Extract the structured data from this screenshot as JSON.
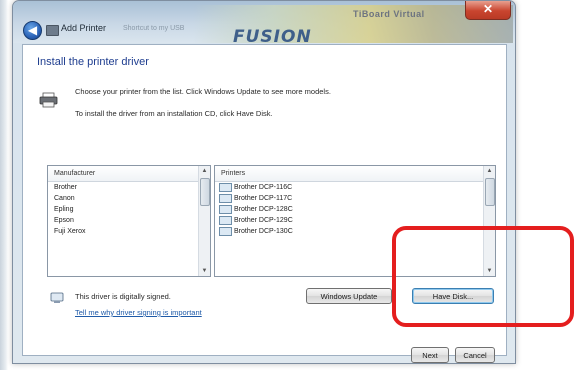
{
  "window": {
    "title": "Add Printer",
    "close_glyph": "✕",
    "back_glyph": "◀",
    "banner_brand": "FUSION",
    "banner_top_text": "TiBoard Virtual",
    "ghost_text": "Shortcut to my USB"
  },
  "page": {
    "heading": "Install the printer driver",
    "instruction_1": "Choose your printer from the list. Click Windows Update to see more models.",
    "instruction_2": "To install the driver from an installation CD, click Have Disk."
  },
  "manufacturer_list": {
    "header": "Manufacturer",
    "items": [
      "Brother",
      "Canon",
      "Epling",
      "Epson",
      "Fuji Xerox"
    ]
  },
  "printers_list": {
    "header": "Printers",
    "items": [
      "Brother DCP-116C",
      "Brother DCP-117C",
      "Brother DCP-128C",
      "Brother DCP-129C",
      "Brother DCP-130C"
    ]
  },
  "signature": {
    "status": "This driver is digitally signed.",
    "link": "Tell me why driver signing is important"
  },
  "buttons": {
    "windows_update": "Windows Update",
    "have_disk": "Have Disk...",
    "next": "Next",
    "cancel": "Cancel"
  },
  "colors": {
    "heading": "#1e3d8f",
    "link": "#1e5aa8",
    "callout": "#e41e1e",
    "close": "#c9452f"
  }
}
